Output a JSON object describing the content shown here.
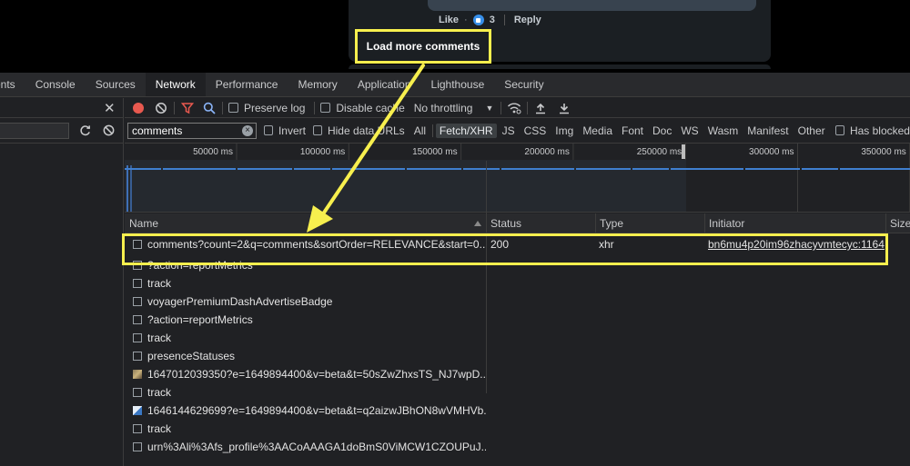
{
  "comment": {
    "like_label": "Like",
    "reaction_count": "3",
    "reply_label": "Reply",
    "load_more_label": "Load more comments"
  },
  "devtools": {
    "tabs": [
      {
        "label": "ents"
      },
      {
        "label": "Console"
      },
      {
        "label": "Sources"
      },
      {
        "label": "Network"
      },
      {
        "label": "Performance"
      },
      {
        "label": "Memory"
      },
      {
        "label": "Application"
      },
      {
        "label": "Lighthouse"
      },
      {
        "label": "Security"
      }
    ],
    "active_tab": "Network",
    "toolbar": {
      "preserve_log_label": "Preserve log",
      "disable_cache_label": "Disable cache",
      "throttling_value": "No throttling"
    },
    "filter": {
      "value": "comments",
      "invert_label": "Invert",
      "hide_data_urls_label": "Hide data URLs",
      "types": [
        "All",
        "Fetch/XHR",
        "JS",
        "CSS",
        "Img",
        "Media",
        "Font",
        "Doc",
        "WS",
        "Wasm",
        "Manifest",
        "Other"
      ],
      "active_type": "Fetch/XHR",
      "has_blocked_label": "Has blocked"
    },
    "timeline_ticks": [
      "50000 ms",
      "100000 ms",
      "150000 ms",
      "200000 ms",
      "250000 ms",
      "300000 ms",
      "350000 ms"
    ],
    "columns": [
      "Name",
      "Status",
      "Type",
      "Initiator",
      "Size"
    ],
    "requests": [
      {
        "name": "comments?count=2&q=comments&sortOrder=RELEVANCE&start=0...",
        "status": "200",
        "type": "xhr",
        "initiator": "bn6mu4p20im96zhacyvmtecyc:1164",
        "icon": "checkbox"
      },
      {
        "name": "?action=reportMetrics",
        "status": "",
        "type": "",
        "initiator": "",
        "icon": "checkbox"
      },
      {
        "name": "track",
        "status": "",
        "type": "",
        "initiator": "",
        "icon": "checkbox"
      },
      {
        "name": "voyagerPremiumDashAdvertiseBadge",
        "status": "",
        "type": "",
        "initiator": "",
        "icon": "checkbox"
      },
      {
        "name": "?action=reportMetrics",
        "status": "",
        "type": "",
        "initiator": "",
        "icon": "checkbox"
      },
      {
        "name": "track",
        "status": "",
        "type": "",
        "initiator": "",
        "icon": "checkbox"
      },
      {
        "name": "presenceStatuses",
        "status": "",
        "type": "",
        "initiator": "",
        "icon": "checkbox"
      },
      {
        "name": "1647012039350?e=1649894400&v=beta&t=50sZwZhxsTS_NJ7wpD...",
        "status": "",
        "type": "",
        "initiator": "",
        "icon": "image"
      },
      {
        "name": "track",
        "status": "",
        "type": "",
        "initiator": "",
        "icon": "checkbox"
      },
      {
        "name": "1646144629699?e=1649894400&v=beta&t=q2aizwJBhON8wVMHVb...",
        "status": "",
        "type": "",
        "initiator": "",
        "icon": "image2"
      },
      {
        "name": "track",
        "status": "",
        "type": "",
        "initiator": "",
        "icon": "checkbox"
      },
      {
        "name": "urn%3Ali%3Afs_profile%3AACoAAAGA1doBmS0ViMCW1CZOUPuJ...",
        "status": "",
        "type": "",
        "initiator": "",
        "icon": "checkbox"
      }
    ]
  },
  "colors": {
    "highlight": "#f7ef4e",
    "devtools_bg": "#202124",
    "record_red": "#e8594f",
    "filter_red": "#e8594f",
    "accent_blue": "#4d90fe"
  }
}
